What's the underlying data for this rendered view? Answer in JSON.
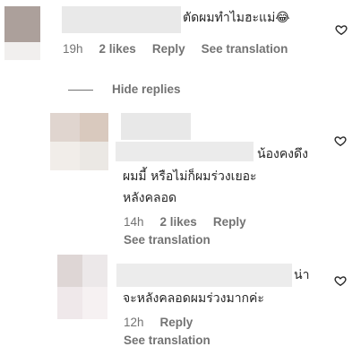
{
  "comments": [
    {
      "text": "ตัดผมทำไมฮะแม่",
      "emoji": "😂",
      "time": "19h",
      "likes": "2 likes",
      "reply": "Reply",
      "translate": "See translation"
    },
    {
      "line1": "น้องคงดึง",
      "line2": "ผมมี้ หรือไม่ก็ผมร่วงเยอะ",
      "line3": "หลังคลอด",
      "time": "14h",
      "likes": "2 likes",
      "reply": "Reply",
      "translate": "See translation"
    },
    {
      "line1": "น่า",
      "line2": "จะหลังคลอดผมร่วงมากค่ะ",
      "time": "12h",
      "reply": "Reply",
      "translate": "See translation"
    }
  ],
  "hide_replies": "Hide replies",
  "colors": {
    "text": "#262626",
    "secondary": "#737373"
  }
}
